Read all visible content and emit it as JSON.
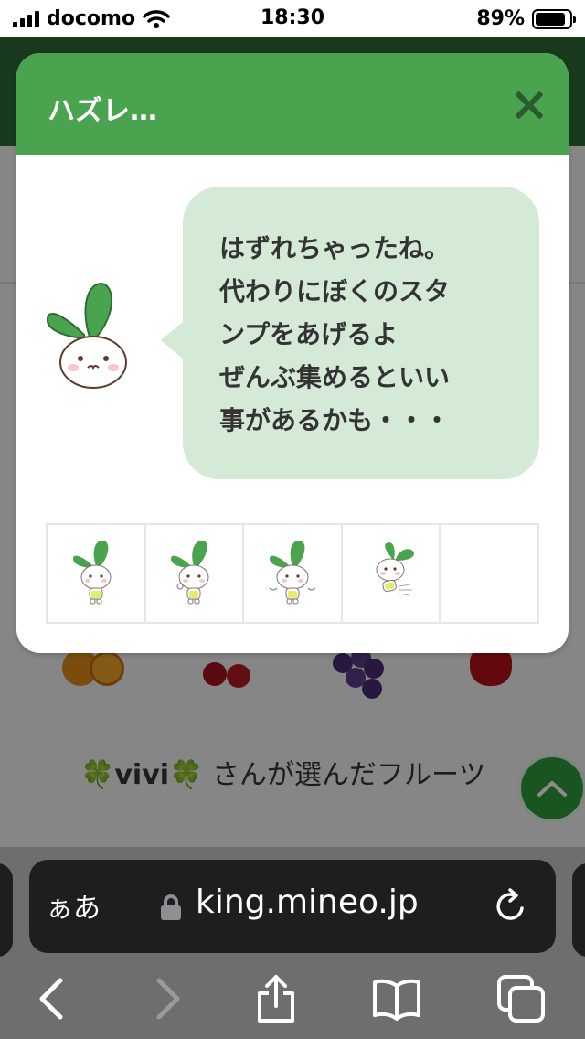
{
  "status_bar": {
    "carrier": "docomo",
    "time": "18:30",
    "battery_percent": "89%",
    "battery_level": 0.89
  },
  "background_page": {
    "picked_line": {
      "clover_left": "🍀",
      "user_name": "vivi",
      "clover_right": "🍀",
      "suffix": " さんが選んだフルーツ"
    },
    "scroll_top_icon": "chevron-up-icon"
  },
  "modal": {
    "title": "ハズレ…",
    "close_icon": "close-icon",
    "message_lines": [
      "はずれちゃったね。",
      "代わりにぼくのスタ",
      "ンプをあげるよ",
      "ぜんぶ集めるといい",
      "事があるかも・・・"
    ],
    "stamp_slots": [
      {
        "icon": "mascot-standing-stamp",
        "filled": true
      },
      {
        "icon": "mascot-thinking-stamp",
        "filled": true
      },
      {
        "icon": "mascot-waving-stamp",
        "filled": true
      },
      {
        "icon": "mascot-running-stamp",
        "filled": true
      },
      {
        "icon": "empty-stamp-slot",
        "filled": false
      }
    ],
    "colors": {
      "header": "#4aa34e",
      "bubble": "#d4ead7",
      "mascot_leaf": "#4aa34e"
    }
  },
  "browser": {
    "aa_label": "ぁあ",
    "url": "king.mineo.jp",
    "toolbar_icons": [
      "back-icon",
      "forward-icon",
      "share-icon",
      "bookmarks-icon",
      "tabs-icon"
    ]
  }
}
